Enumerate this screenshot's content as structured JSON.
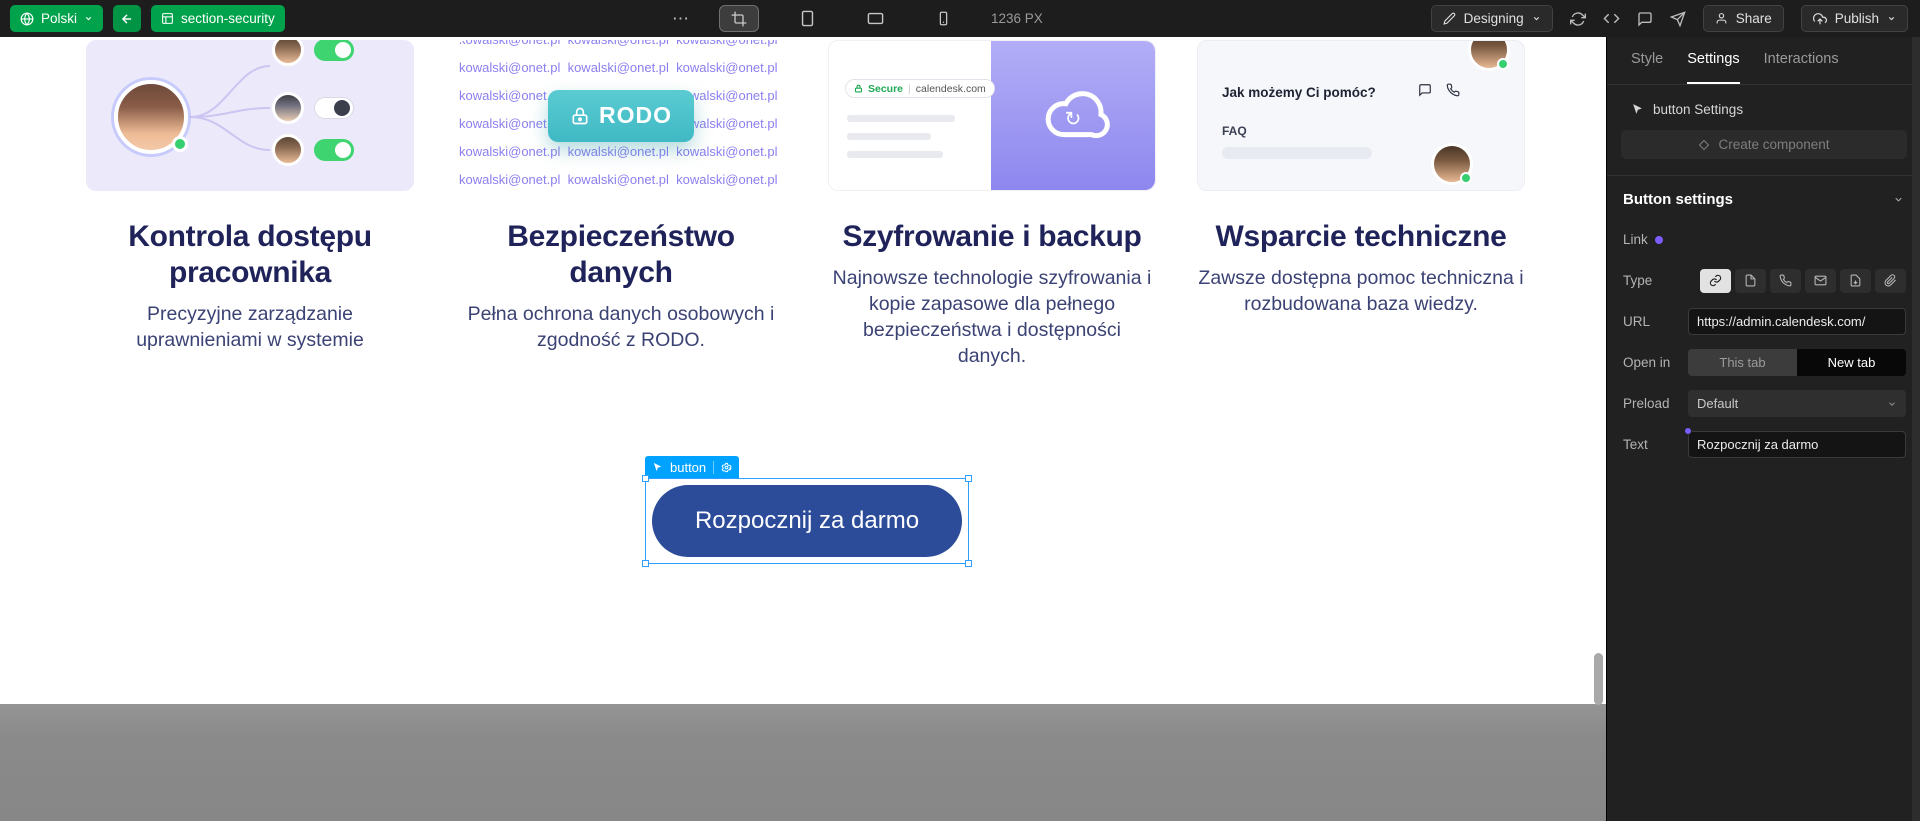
{
  "topbar": {
    "language_label": "Polski",
    "section_badge": "section-security",
    "more_label": "⋯",
    "width_label": "1236 PX",
    "mode_label": "Designing",
    "share_label": "Share",
    "publish_label": "Publish"
  },
  "canvas": {
    "cards": [
      {
        "title": "Kontrola dostępu pracownika",
        "body": "Precyzyjne zarządzanie uprawnieniami w systemie"
      },
      {
        "title": "Bezpieczeństwo danych",
        "body": "Pełna ochrona danych osobowych i zgodność z RODO."
      },
      {
        "title": "Szyfrowanie i backup",
        "body": "Najnowsze technologie szyfrowania i kopie zapasowe dla pełnego bezpieczeństwa i dostępności danych."
      },
      {
        "title": "Wsparcie techniczne",
        "body": "Zawsze dostępna pomoc techniczna i rozbudowana baza wiedzy."
      }
    ],
    "card2": {
      "email_row": "kowalski@onet.pl  kowalski@onet.pl  kowalski@onet.pl  kowalski@onet.pl",
      "badge": "RODO"
    },
    "card3": {
      "secure": "Secure",
      "divider": "|",
      "domain": "calendesk.com",
      "refresh_glyph": "↻"
    },
    "card4": {
      "header": "Jak możemy Ci pomóc?",
      "faq": "FAQ"
    },
    "selected_button": {
      "tag": "button",
      "label": "Rozpocznij za darmo"
    }
  },
  "panel": {
    "tabs": [
      {
        "label": "Style"
      },
      {
        "label": "Settings"
      },
      {
        "label": "Interactions"
      }
    ],
    "context_label": "button Settings",
    "create_component_label": "Create component",
    "section_title": "Button settings",
    "link_label": "Link",
    "type_label": "Type",
    "url_label": "URL",
    "url_value": "https://admin.calendesk.com/",
    "open_in_label": "Open in",
    "open_in_options": [
      "This tab",
      "New tab"
    ],
    "preload_label": "Preload",
    "preload_value": "Default",
    "text_label": "Text",
    "text_value": "Rozpocznij za darmo"
  },
  "colors": {
    "brand_green": "#00A24B",
    "selection_blue": "#00A2FF",
    "button_blue": "#2C4C9A",
    "accent_purple": "#7C5CFF",
    "rodo_teal": "#4BC4CB"
  }
}
